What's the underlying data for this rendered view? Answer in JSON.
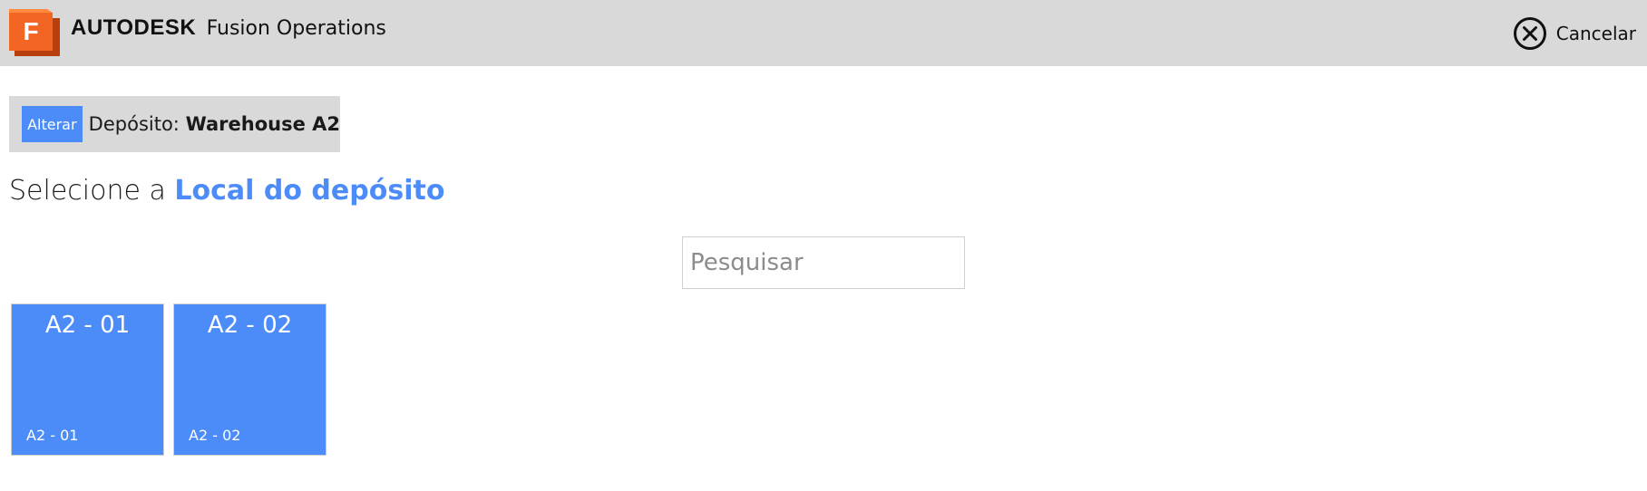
{
  "header": {
    "brand_company": "AUTODESK",
    "brand_product": "Fusion Operations",
    "logo_letter": "F",
    "logo_icon": "fusion-logo-icon",
    "cancel_label": "Cancelar",
    "cancel_icon": "close-circle-icon"
  },
  "warehouse": {
    "alter_label": "Alterar",
    "prefix": "Depósito:",
    "name": "Warehouse A2"
  },
  "heading": {
    "prefix": "Selecione a",
    "accent": "Local do depósito"
  },
  "search": {
    "placeholder": "Pesquisar",
    "value": ""
  },
  "locations": [
    {
      "title": "A2 - 01",
      "subtitle": "A2 - 01"
    },
    {
      "title": "A2 - 02",
      "subtitle": "A2 - 02"
    }
  ],
  "colors": {
    "accent": "#4c8cf8",
    "topbar": "#d9d9d9",
    "logo_orange": "#f26522",
    "logo_dark": "#b83e0c"
  }
}
